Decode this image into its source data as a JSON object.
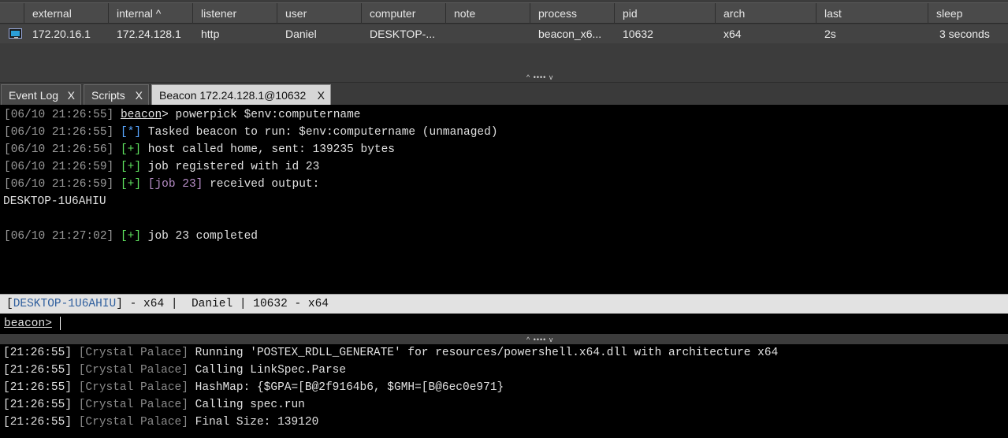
{
  "table": {
    "columns": [
      {
        "label": "external"
      },
      {
        "label": "internal ^"
      },
      {
        "label": "listener"
      },
      {
        "label": "user"
      },
      {
        "label": "computer"
      },
      {
        "label": "note"
      },
      {
        "label": "process"
      },
      {
        "label": "pid"
      },
      {
        "label": "arch"
      },
      {
        "label": "last"
      },
      {
        "label": "sleep"
      }
    ],
    "rows": [
      {
        "external": "172.20.16.1",
        "internal": "172.24.128.1",
        "listener": "http",
        "user": "Daniel",
        "computer": "DESKTOP-...",
        "note": "",
        "process": "beacon_x6...",
        "pid": "10632",
        "arch": "x64",
        "last": "2s",
        "sleep": "3 seconds"
      }
    ]
  },
  "splitter": {
    "grip": "^ •••• v"
  },
  "tabs": [
    {
      "label": "Event Log",
      "close": "X"
    },
    {
      "label": "Scripts",
      "close": "X"
    },
    {
      "label": "Beacon 172.24.128.1@10632",
      "close": "X"
    }
  ],
  "console": {
    "lines": [
      {
        "ts": "[06/10 21:26:55]",
        "prompt": "beacon",
        "cmd": "> powerpick $env:computername"
      },
      {
        "ts": "[06/10 21:26:55]",
        "mark": "[*]",
        "text": " Tasked beacon to run: $env:computername (unmanaged)"
      },
      {
        "ts": "[06/10 21:26:56]",
        "mark": "[+]",
        "text": " host called home, sent: 139235 bytes"
      },
      {
        "ts": "[06/10 21:26:59]",
        "mark": "[+]",
        "text": " job registered with id 23"
      },
      {
        "ts": "[06/10 21:26:59]",
        "mark": "[+]",
        "job": " [job 23]",
        "text": " received output:"
      },
      {
        "text": "DESKTOP-1U6AHIU"
      },
      {
        "ts": "[06/10 21:27:02]",
        "mark": "[+]",
        "text": " job 23 completed"
      }
    ]
  },
  "statusbar": {
    "open": "[",
    "host": "DESKTOP-1U6AHIU",
    "rest": "] - x64 |  Daniel | 10632 - x64"
  },
  "input": {
    "prompt": "beacon>"
  },
  "log": {
    "lines": [
      {
        "ts": "[21:26:55]",
        "src": " [Crystal Palace]",
        "text": " Running 'POSTEX_RDLL_GENERATE' for resources/powershell.x64.dll with architecture x64"
      },
      {
        "ts": "[21:26:55]",
        "src": " [Crystal Palace]",
        "text": " Calling LinkSpec.Parse"
      },
      {
        "ts": "[21:26:55]",
        "src": " [Crystal Palace]",
        "text": " HashMap: {$GPA=[B@2f9164b6, $GMH=[B@6ec0e971}"
      },
      {
        "ts": "[21:26:55]",
        "src": " [Crystal Palace]",
        "text": " Calling spec.run"
      },
      {
        "ts": "[21:26:55]",
        "src": " [Crystal Palace]",
        "text": " Final Size: 139120"
      }
    ]
  }
}
